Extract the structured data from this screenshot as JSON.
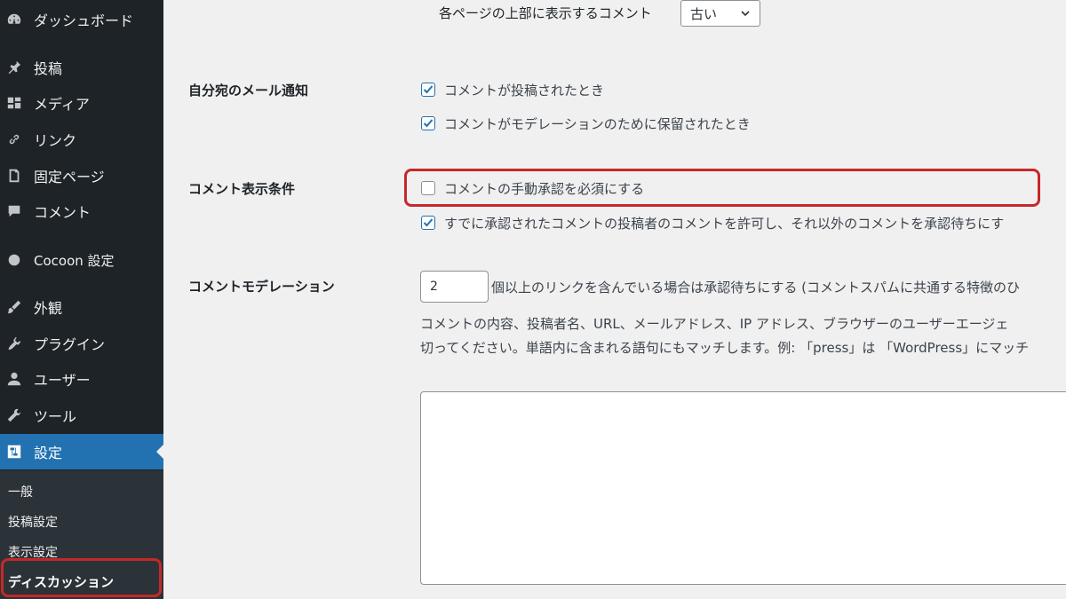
{
  "sidebar": {
    "items": [
      {
        "label": "ダッシュボード",
        "icon": "dashboard-icon"
      },
      {
        "label": "投稿",
        "icon": "pin-icon"
      },
      {
        "label": "メディア",
        "icon": "media-icon"
      },
      {
        "label": "リンク",
        "icon": "link-icon"
      },
      {
        "label": "固定ページ",
        "icon": "page-icon"
      },
      {
        "label": "コメント",
        "icon": "comment-icon"
      },
      {
        "label": "Cocoon 設定",
        "icon": "circle-icon"
      },
      {
        "label": "外観",
        "icon": "brush-icon"
      },
      {
        "label": "プラグイン",
        "icon": "plugin-icon"
      },
      {
        "label": "ユーザー",
        "icon": "user-icon"
      },
      {
        "label": "ツール",
        "icon": "wrench-icon"
      },
      {
        "label": "設定",
        "icon": "settings-icon"
      }
    ],
    "submenu": [
      "一般",
      "投稿設定",
      "表示設定",
      "ディスカッション"
    ]
  },
  "main": {
    "top_comment_label": "各ページの上部に表示するコメント",
    "top_comment_select": "古い",
    "email_section": {
      "title": "自分宛のメール通知",
      "options": [
        "コメントが投稿されたとき",
        "コメントがモデレーションのために保留されたとき"
      ]
    },
    "display_section": {
      "title": "コメント表示条件",
      "options": [
        "コメントの手動承認を必須にする",
        "すでに承認されたコメントの投稿者のコメントを許可し、それ以外のコメントを承認待ちにす"
      ]
    },
    "moderation_section": {
      "title": "コメントモデレーション",
      "link_count": "2",
      "link_text": "個以上のリンクを含んでいる場合は承認待ちにする (コメントスパムに共通する特徴のひ",
      "desc_line1": "コメントの内容、投稿者名、URL、メールアドレス、IP アドレス、ブラウザーのユーザーエージェ",
      "desc_line2": "切ってください。単語内に含まれる語句にもマッチします。例: 「press」は 「WordPress」にマッチ"
    }
  },
  "colors": {
    "sidebar_bg": "#1d2327",
    "active_bg": "#2271b1",
    "highlight": "#c62828"
  }
}
